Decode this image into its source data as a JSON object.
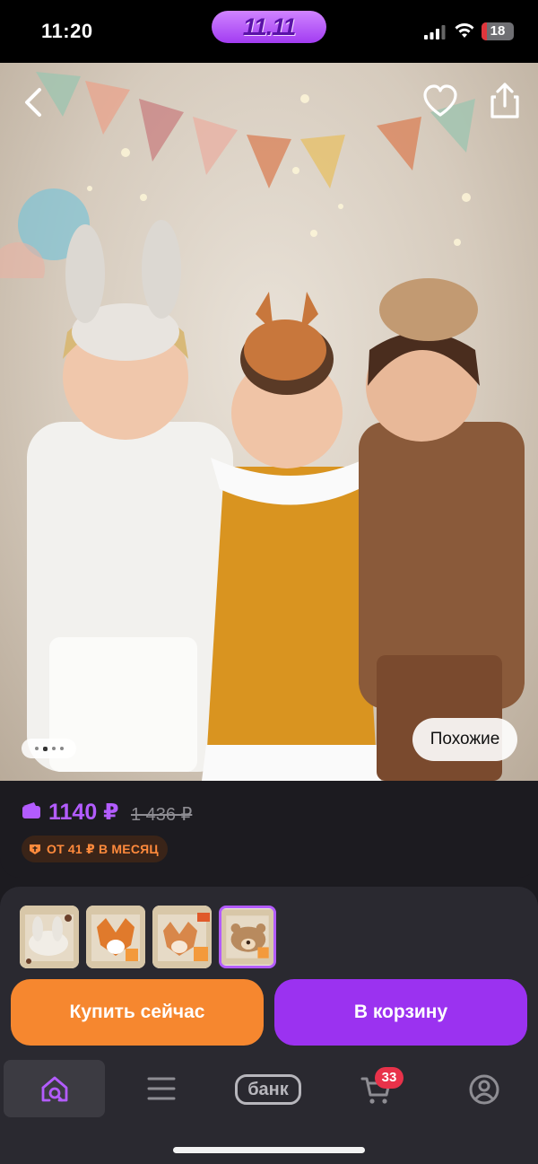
{
  "status_bar": {
    "time": "11:20",
    "promo": "11.11",
    "battery": "18",
    "battery_level": 0.18
  },
  "product": {
    "similar_label": "Похожие",
    "gallery_pages": 4,
    "gallery_current": 2,
    "price": "1140 ₽",
    "old_price": "1 436 ₽",
    "installment": "ОТ 41 ₽ В МЕСЯЦ",
    "price_color": "#b35cff",
    "installment_color": "#ff8a3c"
  },
  "variants": [
    {
      "name": "white-rabbit-mask"
    },
    {
      "name": "fox-mask"
    },
    {
      "name": "fox-mask-2"
    },
    {
      "name": "bear-mask"
    }
  ],
  "actions": {
    "buy_now": "Купить сейчас",
    "add_to_cart": "В корзину",
    "buy_color": "#f6872f",
    "cart_color": "#9b32f0"
  },
  "tab_bar": {
    "bank_label": "банк",
    "cart_count": "33"
  },
  "icons": [
    "back-icon",
    "heart-icon",
    "share-icon",
    "wallet-icon",
    "installment-icon",
    "home-search-icon",
    "menu-icon",
    "cart-icon",
    "profile-icon",
    "signal-icon",
    "wifi-icon"
  ]
}
